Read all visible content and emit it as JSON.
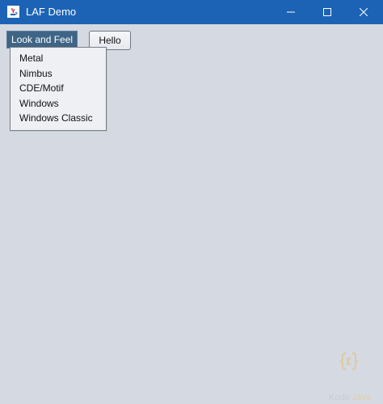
{
  "window": {
    "title": "LAF Demo",
    "titlebar_color": "#1c63b5",
    "minimize_icon": "minimize-icon",
    "maximize_icon": "maximize-icon",
    "close_icon": "close-icon"
  },
  "menubar": {
    "menu_label": "Look and Feel"
  },
  "hello_button": {
    "label": "Hello"
  },
  "popup_menu": {
    "items": [
      "Metal",
      "Nimbus",
      "CDE/Motif",
      "Windows",
      "Windows Classic"
    ]
  },
  "watermark": {
    "text_part1": "Kode",
    "text_part2": "Java"
  }
}
